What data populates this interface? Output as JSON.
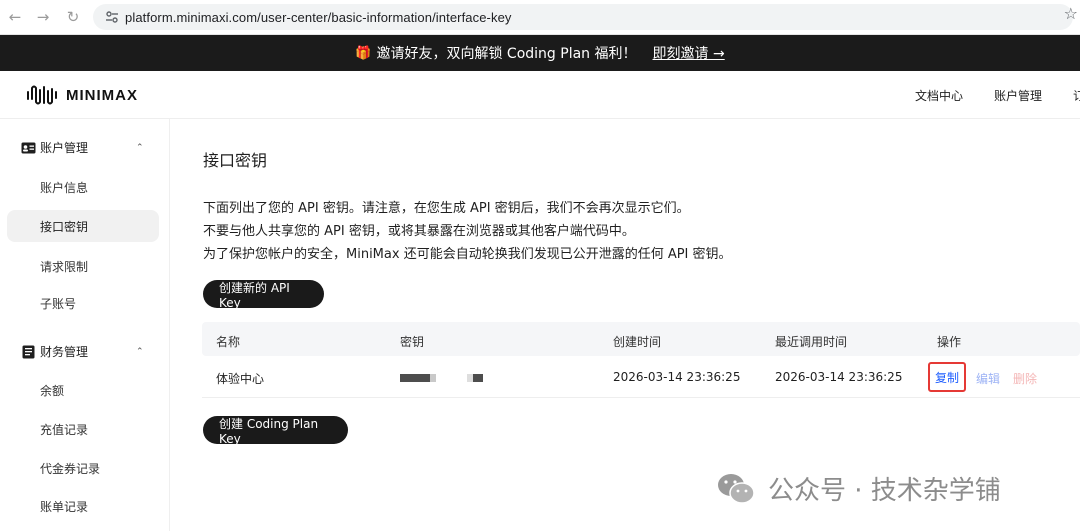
{
  "browser": {
    "url": "platform.minimaxi.com/user-center/basic-information/interface-key"
  },
  "promo": {
    "text": "邀请好友，双向解锁 Coding Plan 福利！",
    "link": "即刻邀请 →"
  },
  "header": {
    "logo": "MINIMAX",
    "nav": [
      "文档中心",
      "账户管理",
      "订"
    ]
  },
  "sidebar": {
    "groups": [
      {
        "label": "账户管理",
        "items": [
          "账户信息",
          "接口密钥",
          "请求限制",
          "子账号"
        ]
      },
      {
        "label": "财务管理",
        "items": [
          "余额",
          "充值记录",
          "代金券记录",
          "账单记录"
        ]
      }
    ],
    "active_item": "接口密钥"
  },
  "main": {
    "title": "接口密钥",
    "description": [
      "下面列出了您的 API 密钥。请注意，在您生成 API 密钥后，我们不会再次显示它们。",
      "不要与他人共享您的 API 密钥，或将其暴露在浏览器或其他客户端代码中。",
      "为了保护您帐户的安全，MiniMax 还可能会自动轮换我们发现已公开泄露的任何 API 密钥。"
    ],
    "create_api_key_button": "创建新的 API Key",
    "create_coding_plan_button": "创建 Coding Plan Key",
    "table": {
      "headers": [
        "名称",
        "密钥",
        "创建时间",
        "最近调用时间",
        "操作"
      ],
      "rows": [
        {
          "name": "体验中心",
          "created": "2026-03-14 23:36:25",
          "last_called": "2026-03-14 23:36:25",
          "actions": [
            "复制",
            "编辑",
            "删除"
          ]
        }
      ]
    }
  },
  "watermark": {
    "text": "公众号 · 技术杂学铺"
  },
  "colors": {
    "banner_bg": "#1b1b1b",
    "primary_link": "#1e5eff",
    "highlight_border": "#e53935",
    "delete": "#f4b6b6"
  }
}
